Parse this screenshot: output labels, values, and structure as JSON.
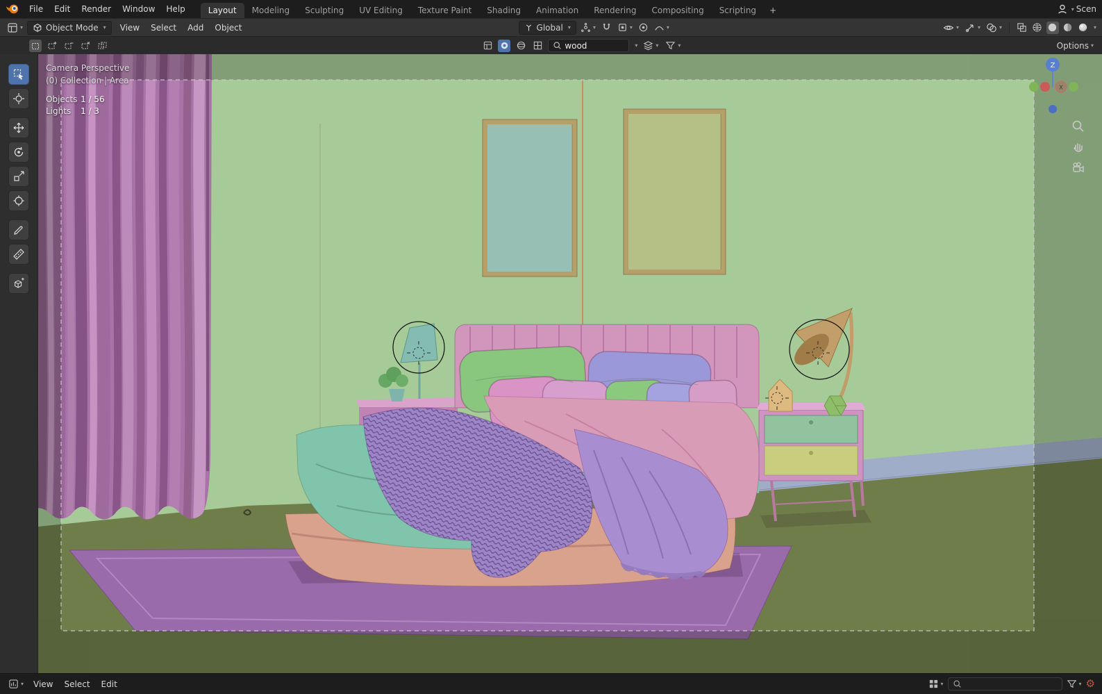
{
  "topbar": {
    "menus": [
      "File",
      "Edit",
      "Render",
      "Window",
      "Help"
    ],
    "tabs": [
      {
        "label": "Layout"
      },
      {
        "label": "Modeling"
      },
      {
        "label": "Sculpting"
      },
      {
        "label": "UV Editing"
      },
      {
        "label": "Texture Paint"
      },
      {
        "label": "Shading"
      },
      {
        "label": "Animation"
      },
      {
        "label": "Rendering"
      },
      {
        "label": "Compositing"
      },
      {
        "label": "Scripting"
      }
    ],
    "add_tab": "+",
    "scene_label": "Scen"
  },
  "viewport_header": {
    "mode": "Object Mode",
    "menus": [
      "View",
      "Select",
      "Add",
      "Object"
    ],
    "orientation": "Global"
  },
  "tool_settings": {
    "search_value": "wood",
    "options_label": "Options"
  },
  "viewport": {
    "view_label": "Camera Perspective",
    "collection_label": "(0) Collection | Area",
    "stats": [
      {
        "name": "Objects",
        "value": "1 / 56"
      },
      {
        "name": "Lights",
        "value": "1 / 3"
      }
    ],
    "axis": {
      "x": "X",
      "z": "Z"
    }
  },
  "statusbar": {
    "menus": [
      "View",
      "Select",
      "Edit"
    ]
  },
  "colors": {
    "accent_blue": "#4f74ad",
    "topbar_bg": "#1d1d1d",
    "header_bg": "#343434",
    "wall_green": "#a6ca98",
    "floor_olive": "#6f7d4b",
    "curtain_mauve": "#a873a6",
    "rug_purple": "#9a6bab",
    "bed_base_salmon": "#d8a28d",
    "headboard_pink": "#d295bc",
    "blanket_teal": "#80c4ac",
    "throw_purple": "#9d86c6",
    "duvet_pink": "#d89cb7",
    "duvet_purple": "#a88ed0",
    "pillow_green": "#89c77f",
    "pillow_periwinkle": "#9b98da",
    "baseboard_blue": "#9fadc9",
    "camera_guide_orange": "#d08038",
    "gear_alert_red": "#c4543f"
  }
}
